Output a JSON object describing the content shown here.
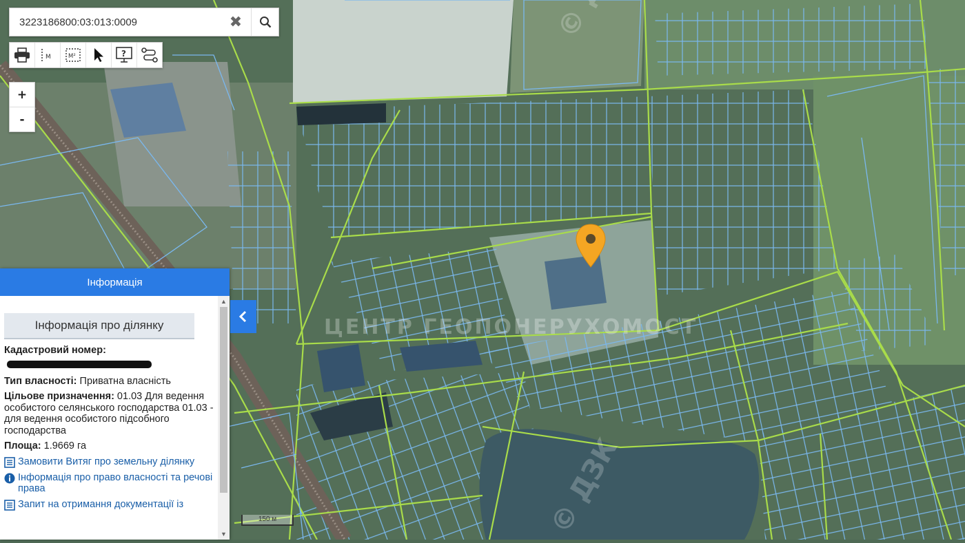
{
  "search": {
    "value": "3223186800:03:013:0009",
    "placeholder": ""
  },
  "toolbar": {
    "tools": [
      {
        "name": "print-icon"
      },
      {
        "name": "measure-length-icon",
        "label": "M"
      },
      {
        "name": "measure-area-icon",
        "label": "M²"
      },
      {
        "name": "select-pointer-icon"
      },
      {
        "name": "info-query-icon",
        "label": "?"
      },
      {
        "name": "route-icon"
      }
    ]
  },
  "zoom": {
    "in": "+",
    "out": "-"
  },
  "map": {
    "marker_color": "#f5a623",
    "parcel_line_color": "#6fb1e8",
    "boundary_line_color": "#a8d94a",
    "watermark_1": "© ДЗК",
    "watermark_2": "© ДЗК",
    "watermark_3": "ЦЕНТР ГЕОПОНЕРУХОМОСТ"
  },
  "panel": {
    "header": "Інформація",
    "subheader": "Інформація про ділянку",
    "cadastral_label": "Кадастровий номер:",
    "ownership_label": "Тип власності:",
    "ownership_value": " Приватна власність",
    "purpose_label": "Цільове призначення:",
    "purpose_value": " 01.03 Для ведення особистого селянського господарства 01.03 - для ведення особистого підсобного господарства",
    "area_label": "Площа:",
    "area_value": " 1.9669 га",
    "links": [
      "Замовити Витяг про земельну ділянку",
      "Інформація про право власності та речові права",
      "Запит на отримання документації із"
    ]
  },
  "scale": {
    "label": "150 м"
  }
}
